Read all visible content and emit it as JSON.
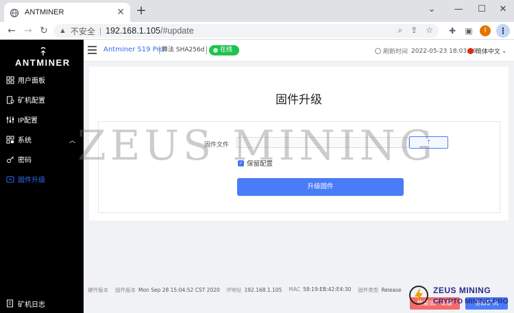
{
  "browser": {
    "tab_title": "ANTMINER",
    "url_warning": "不安全",
    "url_host": "192.168.1.105",
    "url_path": "/#update",
    "avatar_letter": "I"
  },
  "sidebar": {
    "logo_text": "ANTMINER",
    "items": [
      {
        "label": "用户面板"
      },
      {
        "label": "矿机配置"
      },
      {
        "label": "IP配置"
      },
      {
        "label": "系统"
      },
      {
        "label": "密码"
      },
      {
        "label": "固件升级"
      }
    ],
    "log_label": "矿机日志"
  },
  "header": {
    "model": "Antminer S19 Pro",
    "algo": "算法 SHA256d",
    "status": "在线",
    "refresh_label": "刷新时间",
    "refresh_time": "2022-05-23 18:03:49",
    "language": "简体中文"
  },
  "main": {
    "title": "固件升级",
    "file_label": "固件文件",
    "keep_settings_label": "保留配置",
    "keep_settings_checked": true,
    "upgrade_button": "升级固件"
  },
  "footer": {
    "hw_label": "硬件版本",
    "fw_label": "固件版本",
    "fw_value": "Mon Sep 28 15:04:52 CST 2020",
    "ip_label": "IP地址",
    "ip_value": "192.168.1.105",
    "mac_label": "MAC",
    "mac_value": "58:19:EB:42:E4:30",
    "type_label": "固件类型",
    "type_value": "Release",
    "reset_button": "恢复出厂设置",
    "reboot_button": "重启矿机"
  },
  "watermark": {
    "big": "ZEUS MINING",
    "logo_line1": "ZEUS MINING",
    "logo_line2": "CRYPTO MINING.PRO"
  },
  "colors": {
    "accent": "#4a7cf7",
    "online": "#21c24f",
    "reset": "#f36b6b",
    "sidebar": "#000000"
  }
}
